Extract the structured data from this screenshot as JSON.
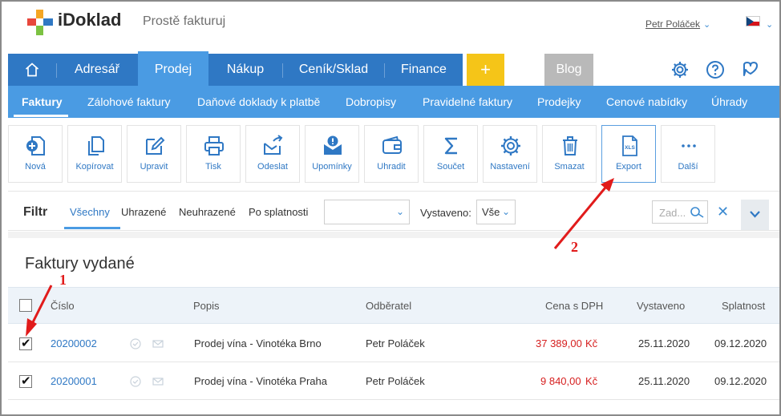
{
  "app": {
    "brand": "iDoklad",
    "tagline": "Prostě fakturuj",
    "user": "Petr Poláček"
  },
  "main_nav": {
    "items": [
      {
        "label": "Adresář"
      },
      {
        "label": "Prodej",
        "active": true
      },
      {
        "label": "Nákup"
      },
      {
        "label": "Ceník/Sklad"
      },
      {
        "label": "Finance"
      }
    ],
    "plus": "+",
    "blog": "Blog"
  },
  "sub_nav": {
    "items": [
      {
        "label": "Faktury",
        "active": true
      },
      {
        "label": "Zálohové faktury"
      },
      {
        "label": "Daňové doklady k platbě"
      },
      {
        "label": "Dobropisy"
      },
      {
        "label": "Pravidelné faktury"
      },
      {
        "label": "Prodejky"
      },
      {
        "label": "Cenové nabídky"
      },
      {
        "label": "Úhrady"
      }
    ]
  },
  "toolbar": {
    "buttons": [
      {
        "label": "Nová",
        "icon": "plus-document-icon"
      },
      {
        "label": "Kopírovat",
        "icon": "copy-icon"
      },
      {
        "label": "Upravit",
        "icon": "edit-icon"
      },
      {
        "label": "Tisk",
        "icon": "print-icon"
      },
      {
        "label": "Odeslat",
        "icon": "send-icon"
      },
      {
        "label": "Upomínky",
        "icon": "reminder-icon"
      },
      {
        "label": "Uhradit",
        "icon": "wallet-icon"
      },
      {
        "label": "Součet",
        "icon": "sigma-icon"
      },
      {
        "label": "Nastavení",
        "icon": "gear-icon"
      },
      {
        "label": "Smazat",
        "icon": "trash-icon"
      },
      {
        "label": "Export",
        "icon": "xls-export-icon",
        "highlighted": true
      },
      {
        "label": "Další",
        "icon": "more-icon"
      }
    ]
  },
  "filter": {
    "title": "Filtr",
    "chips": [
      {
        "label": "Všechny",
        "active": true
      },
      {
        "label": "Uhrazené"
      },
      {
        "label": "Neuhrazené"
      },
      {
        "label": "Po splatnosti"
      }
    ],
    "period_value": "",
    "vystaveno_label": "Vystaveno:",
    "vystaveno_value": "Vše",
    "search_placeholder": "Zad..."
  },
  "table": {
    "title": "Faktury vydané",
    "columns": [
      "Číslo",
      "Popis",
      "Odběratel",
      "Cena s DPH",
      "Vystaveno",
      "Splatnost"
    ],
    "rows": [
      {
        "number": "20200002",
        "description": "Prodej vína - Vinotéka Brno",
        "customer": "Petr Poláček",
        "price": "37 389,00",
        "currency": "Kč",
        "issued": "25.11.2020",
        "due": "09.12.2020",
        "checked": true
      },
      {
        "number": "20200001",
        "description": "Prodej vína - Vinotéka Praha",
        "customer": "Petr Poláček",
        "price": "9 840,00",
        "currency": "Kč",
        "issued": "25.11.2020",
        "due": "09.12.2020",
        "checked": true
      }
    ]
  },
  "annotations": {
    "marker1": "1",
    "marker2": "2",
    "color": "#e11b1b"
  },
  "colors": {
    "primary": "#2f78c4",
    "primary_light": "#4a9be3",
    "accent_yellow": "#f5c518",
    "price_red": "#d62020"
  }
}
